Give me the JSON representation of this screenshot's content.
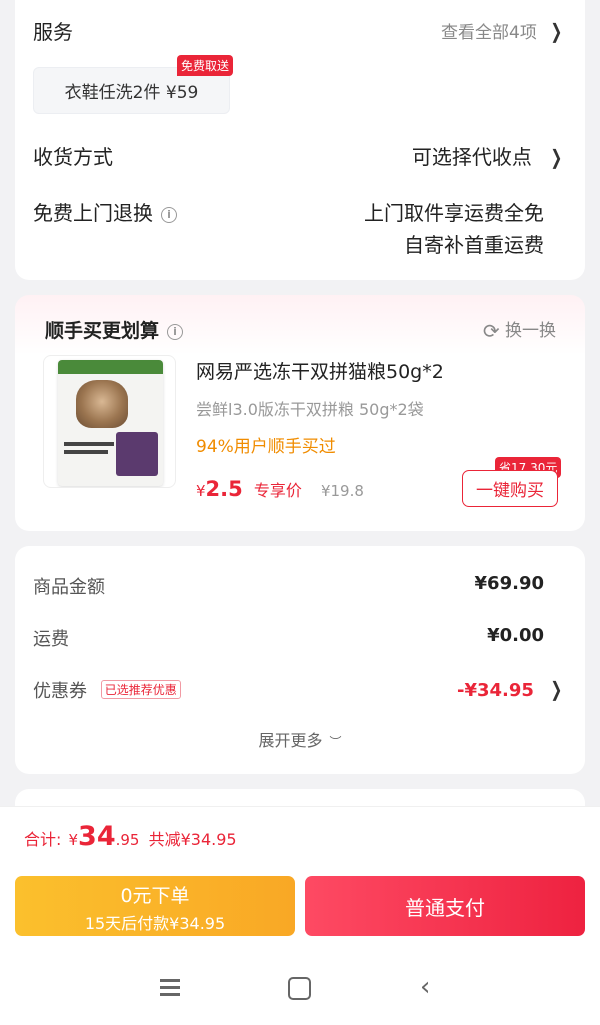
{
  "service": {
    "title": "服务",
    "view_all": "查看全部4项",
    "chip_label": "衣鞋任洗2件 ¥59",
    "chip_badge": "免费取送"
  },
  "delivery": {
    "title": "收货方式",
    "value": "可选择代收点"
  },
  "returns": {
    "title": "免费上门退换",
    "line1": "上门取件享运费全免",
    "line2": "自寄补首重运费"
  },
  "addon": {
    "title": "顺手买更划算",
    "swap": "换一换",
    "product_name": "网易严选冻干双拼猫粮50g*2",
    "product_sub": "尝鲜l3.0版冻干双拼粮 50g*2袋",
    "social_proof": "94%用户顺手买过",
    "price_symbol": "¥",
    "price": "2.5",
    "price_tag": "专享价",
    "orig_price": "¥19.8",
    "save_badge": "省17.30元",
    "buy_button": "一键购买"
  },
  "summary": {
    "goods_label": "商品金额",
    "goods_value": "¥69.90",
    "shipping_label": "运费",
    "shipping_value": "¥0.00",
    "coupon_label": "优惠券",
    "coupon_tag": "已选推荐优惠",
    "coupon_value": "-¥34.95",
    "expand": "展开更多"
  },
  "total": {
    "label": "合计:",
    "symbol": "¥",
    "int": "34",
    "dec": ".95",
    "saved": "共减¥34.95"
  },
  "buttons": {
    "left_line1": "0元下单",
    "left_line2": "15天后付款¥34.95",
    "right": "普通支付"
  },
  "colors": {
    "accent_red": "#ea2538",
    "orange": "#f08c00",
    "yellow_btn": "#fbc02d"
  }
}
